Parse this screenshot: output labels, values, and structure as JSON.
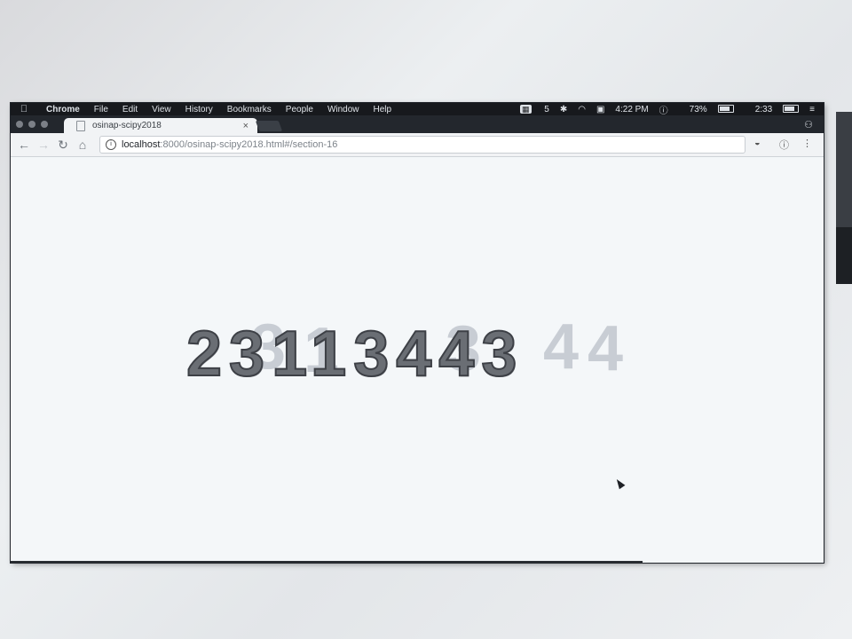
{
  "menubar": {
    "apple_icon": "apple-icon",
    "app": "Chrome",
    "items": [
      "File",
      "Edit",
      "View",
      "History",
      "Bookmarks",
      "People",
      "Window",
      "Help"
    ],
    "status": {
      "notifications": "5",
      "time": "4:22 PM",
      "battery": "73%",
      "timer": "2:33"
    }
  },
  "tab": {
    "title": "osinap-scipy2018",
    "close": "×"
  },
  "toolbar": {
    "back": "←",
    "reload": "C",
    "home": "⌂",
    "url_host": "localhost",
    "url_path": ":8000/osinap-scipy2018.html#/section-16"
  },
  "content": {
    "digits": "23113443",
    "ghost_digits": [
      "3",
      "1",
      "3",
      "4",
      "4"
    ],
    "prev_arrow": "‹",
    "next_arrow": "›"
  }
}
